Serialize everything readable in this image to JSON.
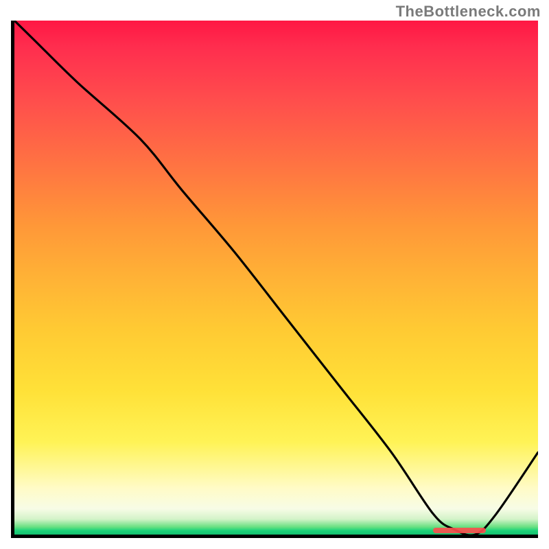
{
  "attribution": "TheBottleneck.com",
  "colors": {
    "top": "#ff1744",
    "mid": "#ffe138",
    "bottom": "#14c06f",
    "axis": "#000000",
    "line": "#000000",
    "marker": "#ff4d4d"
  },
  "chart_data": {
    "type": "line",
    "title": "",
    "xlabel": "",
    "ylabel": "",
    "xlim": [
      0,
      100
    ],
    "ylim": [
      0,
      100
    ],
    "x": [
      0,
      4,
      12,
      24,
      32,
      42,
      52,
      62,
      72,
      80,
      84,
      88,
      92,
      100
    ],
    "values": [
      100,
      96,
      88,
      77,
      67,
      55,
      42,
      29,
      16,
      4,
      1,
      0,
      4,
      16
    ],
    "optimum_range_x": [
      80,
      90
    ]
  }
}
